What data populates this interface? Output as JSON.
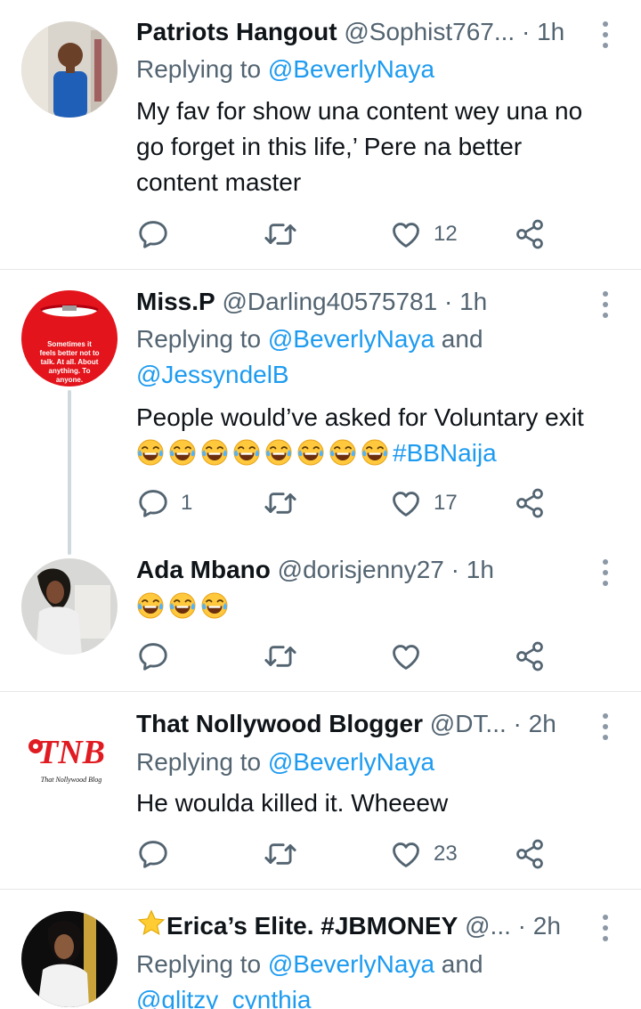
{
  "tweets": [
    {
      "name": "Patriots Hangout",
      "handle": "@Sophist767...",
      "time": "1h",
      "reply_prefix": "Replying to ",
      "reply_to": "@BeverlyNaya",
      "text": "My fav for show  una content wey una no go forget in this life,’ Pere na better content master",
      "replies": "",
      "retweets": "",
      "likes": "12"
    },
    {
      "name": "Miss.P",
      "handle": "@Darling40575781",
      "time": "1h",
      "reply_prefix": "Replying to ",
      "reply_to": "@BeverlyNaya",
      "reply_and": " and",
      "reply_to_2": "@JessyndelB",
      "avatar_text": "Sometimes it feels better not to talk. At all. About anything. To anyone.",
      "text": "People would’ve asked for Voluntary exit ",
      "hashtag": "#BBNaija",
      "replies": "1",
      "retweets": "",
      "likes": "17"
    },
    {
      "name": "Ada Mbano",
      "handle": "@dorisjenny27",
      "time": "1h",
      "replies": "",
      "retweets": "",
      "likes": ""
    },
    {
      "name": "That Nollywood Blogger",
      "handle": "@DT...",
      "time": "2h",
      "reply_prefix": "Replying to ",
      "reply_to": "@BeverlyNaya",
      "logo_text": "TNB",
      "logo_sub": "That Nollywood Blog",
      "text": "He woulda killed it. Wheeew",
      "replies": "",
      "retweets": "",
      "likes": "23"
    },
    {
      "name": "Erica’s Elite. #JBMONEY",
      "handle": "@...",
      "time": "2h",
      "reply_prefix": "Replying to ",
      "reply_to": "@BeverlyNaya",
      "reply_and": " and",
      "reply_to_2": "@glitzy_cynthia"
    }
  ],
  "icons": {
    "reply": "reply-icon",
    "retweet": "retweet-icon",
    "like": "heart-icon",
    "share": "share-icon",
    "more": "more-icon"
  },
  "colors": {
    "link": "#1d9bf0",
    "secondary_text": "#536471",
    "icon": "#536471",
    "divider": "#e7e7e7"
  }
}
